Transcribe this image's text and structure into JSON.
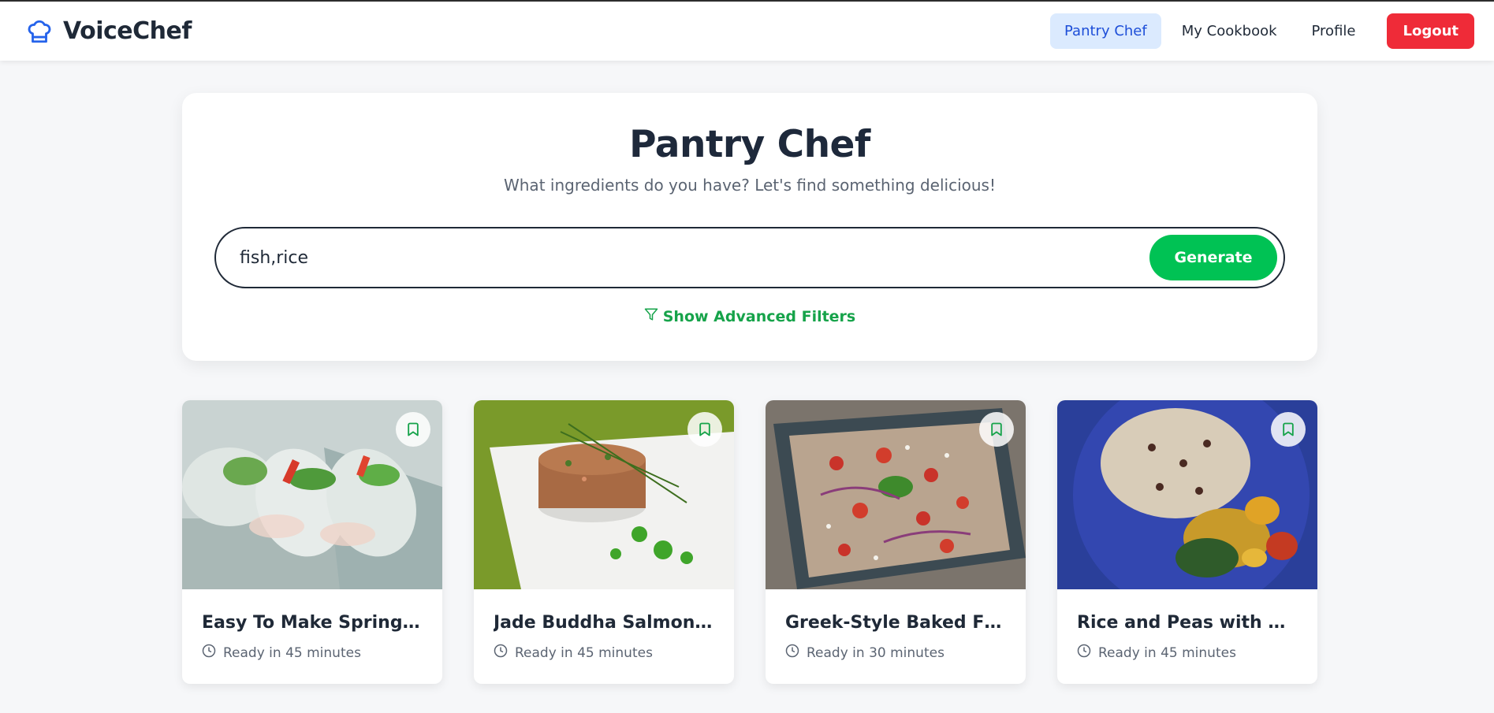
{
  "app": {
    "name": "VoiceChef",
    "icon": "chef-hat-icon",
    "brand_color": "#2563eb"
  },
  "nav": {
    "items": [
      {
        "label": "Pantry Chef",
        "active": true
      },
      {
        "label": "My Cookbook",
        "active": false
      },
      {
        "label": "Profile",
        "active": false
      }
    ],
    "logout_label": "Logout",
    "logout_color": "#ef2b38"
  },
  "hero": {
    "title": "Pantry Chef",
    "subtitle": "What ingredients do you have? Let's find something delicious!",
    "search_value": "fish,rice",
    "generate_label": "Generate",
    "generate_color": "#00c254",
    "filters_label": "Show Advanced Filters",
    "filters_icon": "filter-icon"
  },
  "recipes": [
    {
      "title": "Easy To Make Spring Rolls",
      "time": "Ready in 45 minutes",
      "image": "spring-rolls-photo"
    },
    {
      "title": "Jade Buddha Salmon Tartare",
      "time": "Ready in 45 minutes",
      "image": "salmon-tartare-photo"
    },
    {
      "title": "Greek-Style Baked Fish: Fresh, Simple, and Delicious",
      "time": "Ready in 30 minutes",
      "image": "baked-fish-photo"
    },
    {
      "title": "Rice and Peas with Coconut Curry Mackerel",
      "time": "Ready in 45 minutes",
      "image": "rice-peas-photo"
    }
  ]
}
